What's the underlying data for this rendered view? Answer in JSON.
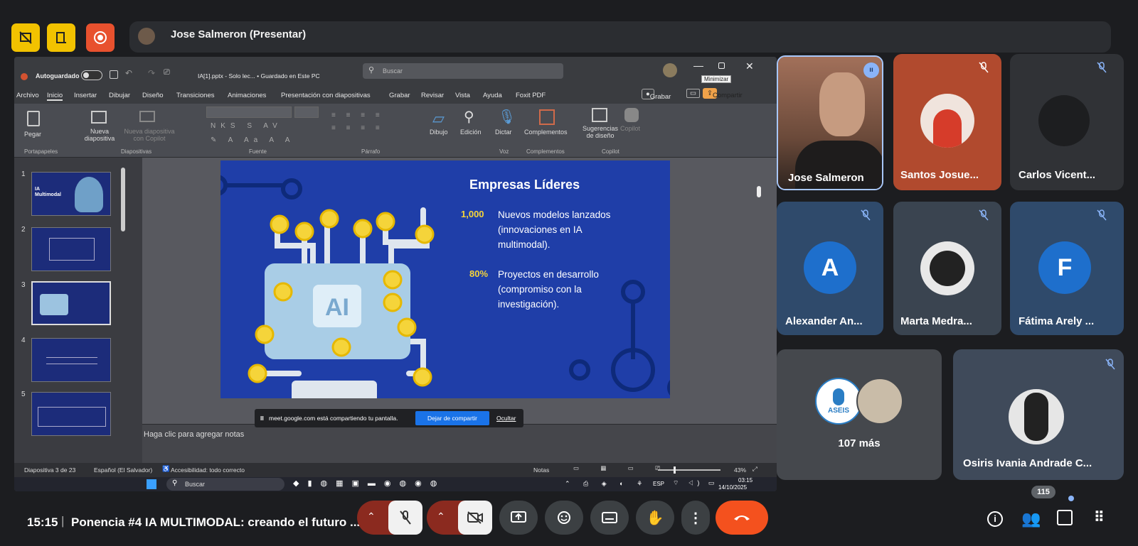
{
  "meeting": {
    "presenter_label": "Jose Salmeron (Presentar)",
    "time": "15:15",
    "separator": "|",
    "title": "Ponencia #4 IA MULTIMODAL: creando el futuro ...",
    "participant_count": "115",
    "more_count": "107 más",
    "colors": {
      "end_call": "#f4511e",
      "camera_off": "#8b2a1f",
      "active_btn": "#3c4043",
      "bg": "#1c1d20"
    }
  },
  "ppt": {
    "autosave_label": "Autoguardado",
    "file_title": "IA[1].pptx - Solo lec... • Guardado en Este PC",
    "search_placeholder": "Buscar",
    "tooltip": "Minimizar",
    "record_label": "Grabar",
    "share_label": "Compartir",
    "tabs": [
      "Archivo",
      "Inicio",
      "Insertar",
      "Dibujar",
      "Diseño",
      "Transiciones",
      "Animaciones",
      "Presentación con diapositivas",
      "Grabar",
      "Revisar",
      "Vista",
      "Ayuda",
      "Foxit PDF"
    ],
    "ribbon": {
      "paste": "Pegar",
      "new_slide": "Nueva diapositiva",
      "copilot_slide": "Nueva diapositiva con Copilot",
      "drawing": "Dibujo",
      "editing": "Edición",
      "dictate": "Dictar",
      "addins": "Complementos",
      "design_ideas": "Sugerencias de diseño",
      "copilot": "Copilot",
      "groups": [
        "Portapapeles",
        "Diapositivas",
        "Fuente",
        "Párrafo",
        "Voz",
        "Complementos",
        "Copilot"
      ]
    },
    "slide_numbers": [
      "1",
      "2",
      "3",
      "4",
      "5"
    ],
    "thumb1_title": "IA Multimodal",
    "slide": {
      "title": "Empresas Líderes",
      "stat1_value": "1,000",
      "stat1_text": "Nuevos modelos lanzados (innovaciones en IA multimodal).",
      "stat2_value": "80%",
      "stat2_text": "Proyectos en desarrollo (compromiso con la investigación).",
      "chip_label": "AI"
    },
    "notes_placeholder": "Haga clic para agregar notas",
    "share_banner": {
      "pause_icon": "II",
      "text": "meet.google.com está compartiendo tu pantalla.",
      "stop_label": "Dejar de compartir",
      "hide_label": "Ocultar"
    },
    "status": {
      "slide_info": "Diapositiva 3 de 23",
      "language": "Español (El Salvador)",
      "accessibility": "Accesibilidad: todo correcto",
      "notes": "Notas",
      "zoom": "43%"
    },
    "taskbar": {
      "search": "Buscar",
      "lang": "ESP",
      "time": "03:15",
      "date": "14/10/2025"
    }
  },
  "participants": [
    {
      "name": "Jose Salmeron",
      "type": "video"
    },
    {
      "name": "Santos Josue...",
      "muted": true
    },
    {
      "name": "Carlos Vicent...",
      "muted": true
    },
    {
      "name": "Alexander An...",
      "initial": "A",
      "muted": true
    },
    {
      "name": "Marta Medra...",
      "muted": true
    },
    {
      "name": "Fátima Arely ...",
      "initial": "F",
      "muted": true
    },
    {
      "name": "Osiris Ivania Andrade C...",
      "muted": true
    }
  ],
  "asei_logo_text": "ASEIS"
}
